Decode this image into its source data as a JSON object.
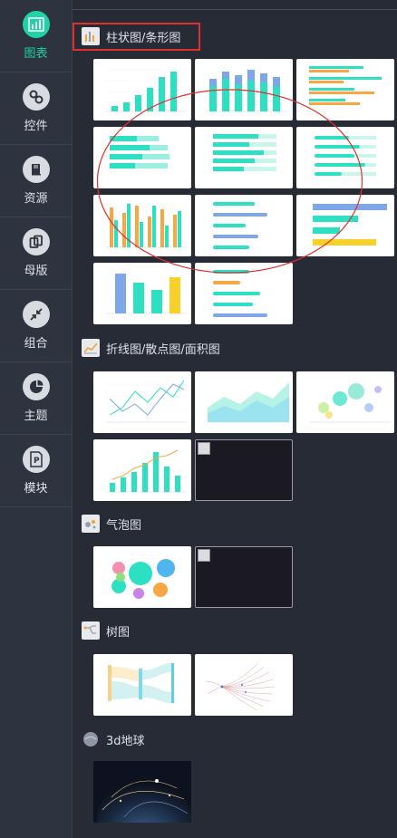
{
  "sidebar": {
    "items": [
      {
        "label": "图表",
        "icon": "bar-chart-icon",
        "active": true
      },
      {
        "label": "控件",
        "icon": "link-icon",
        "active": false
      },
      {
        "label": "资源",
        "icon": "book-icon",
        "active": false
      },
      {
        "label": "母版",
        "icon": "copy-icon",
        "active": false
      },
      {
        "label": "组合",
        "icon": "compress-icon",
        "active": false
      },
      {
        "label": "主题",
        "icon": "pie-icon",
        "active": false
      },
      {
        "label": "模块",
        "icon": "p-module-icon",
        "active": false
      }
    ]
  },
  "sections": {
    "bar": {
      "title": "柱状图/条形图"
    },
    "line": {
      "title": "折线图/散点图/面积图"
    },
    "bubble": {
      "title": "气泡图"
    },
    "tree": {
      "title": "树图"
    },
    "globe": {
      "title": "3d地球"
    }
  },
  "colors": {
    "accent": "#1ed3a4",
    "annotation": "#e0302b",
    "teal": "#2de0c1",
    "orange": "#f7a644",
    "blue": "#7ea7ea",
    "yellow": "#f8d02a"
  }
}
